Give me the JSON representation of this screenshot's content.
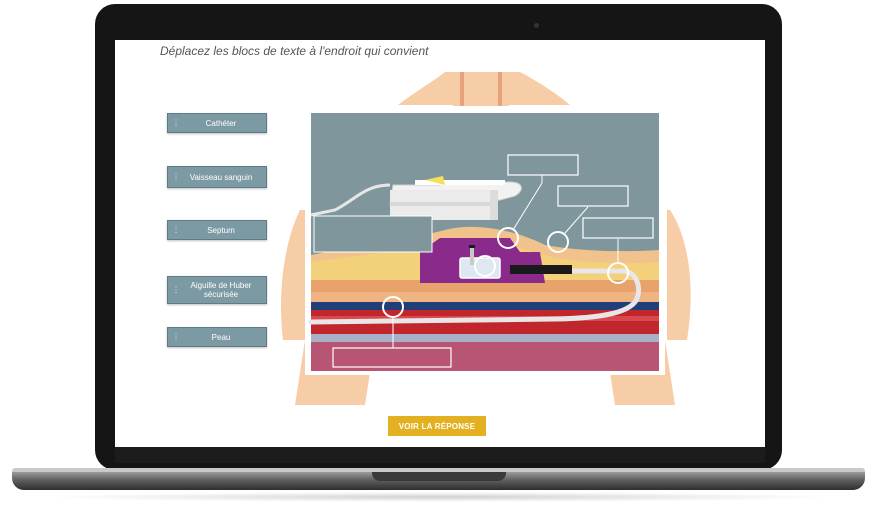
{
  "instruction": "Déplacez les blocs de texte à l'endroit qui convient",
  "labels": [
    {
      "id": "catheter",
      "text": "Cathéter"
    },
    {
      "id": "vessel",
      "text": "Vaisseau sanguin"
    },
    {
      "id": "septum",
      "text": "Septum"
    },
    {
      "id": "needle",
      "text": "Aiguille de Huber sécurisée"
    },
    {
      "id": "skin",
      "text": "Peau"
    }
  ],
  "reveal_button": "VOIR LA RÉPONSE",
  "colors": {
    "label_bg": "#7c9aa3",
    "button": "#e3b021",
    "skin": "#f6cda7",
    "port": "#8a2a8a",
    "vessel": "#c0262c",
    "muscle": "#b85575"
  },
  "icons": {
    "grip": "vertical-dots-icon"
  }
}
